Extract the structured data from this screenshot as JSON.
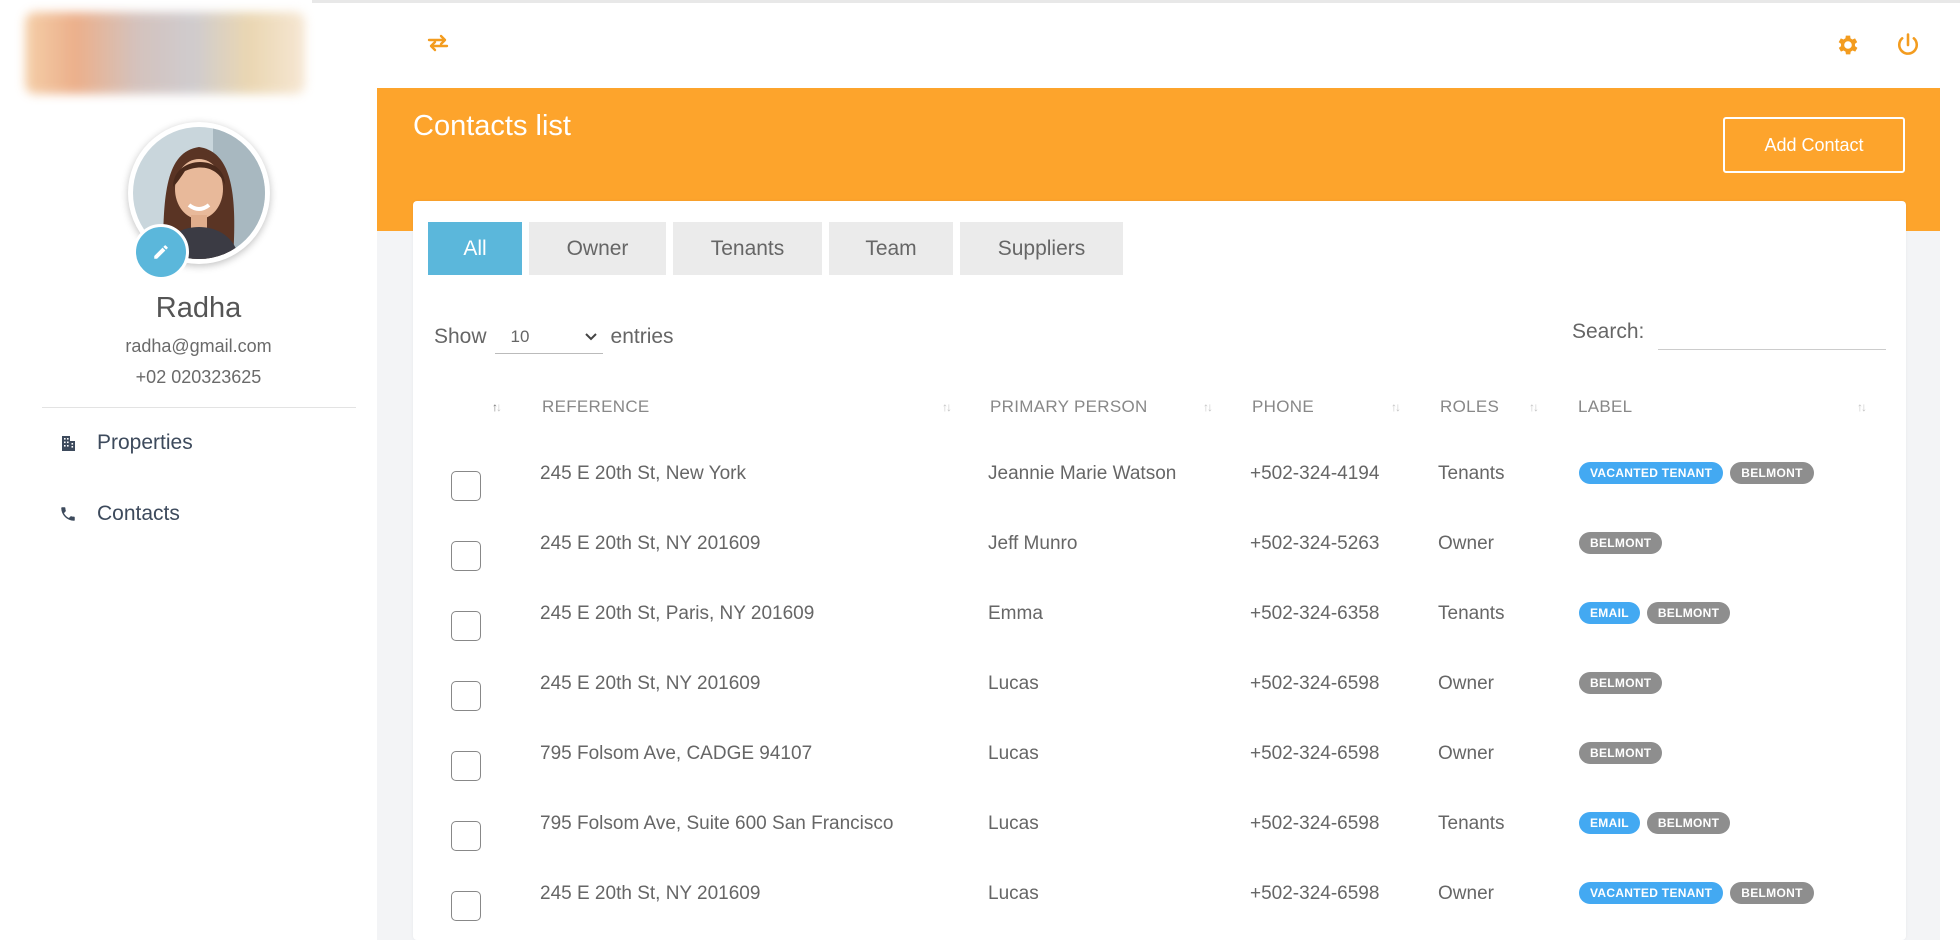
{
  "profile": {
    "name": "Radha",
    "email": "radha@gmail.com",
    "phone": "+02 020323625"
  },
  "nav": {
    "properties_label": "Properties",
    "contacts_label": "Contacts"
  },
  "page": {
    "title": "Contacts list",
    "add_button_label": "Add Contact"
  },
  "tabs": [
    {
      "label": "All",
      "active": true
    },
    {
      "label": "Owner",
      "active": false
    },
    {
      "label": "Tenants",
      "active": false
    },
    {
      "label": "Team",
      "active": false
    },
    {
      "label": "Suppliers",
      "active": false
    }
  ],
  "table_controls": {
    "show_label": "Show",
    "entries_value": "10",
    "entries_label": "entries",
    "search_label": "Search:",
    "search_value": ""
  },
  "columns": {
    "reference": "REFERENCE",
    "primary_person": "PRIMARY PERSON",
    "phone": "PHONE",
    "roles": "ROLES",
    "label": "LABEL"
  },
  "rows": [
    {
      "reference": "245 E 20th St, New York",
      "person": "Jeannie Marie Watson",
      "phone": "+502-324-4194",
      "role": "Tenants",
      "labels": [
        "VACANTED TENANT",
        "BELMONT"
      ]
    },
    {
      "reference": "245 E 20th St, NY 201609",
      "person": "Jeff Munro",
      "phone": "+502-324-5263",
      "role": "Owner",
      "labels": [
        "BELMONT"
      ]
    },
    {
      "reference": "245 E 20th St, Paris, NY 201609",
      "person": "Emma",
      "phone": "+502-324-6358",
      "role": "Tenants",
      "labels": [
        "EMAIL",
        "BELMONT"
      ]
    },
    {
      "reference": "245 E 20th St, NY 201609",
      "person": "Lucas",
      "phone": "+502-324-6598",
      "role": "Owner",
      "labels": [
        "BELMONT"
      ]
    },
    {
      "reference": "795 Folsom Ave, CADGE 94107",
      "person": "Lucas",
      "phone": "+502-324-6598",
      "role": "Owner",
      "labels": [
        "BELMONT"
      ]
    },
    {
      "reference": "795 Folsom Ave, Suite 600 San Francisco",
      "person": "Lucas",
      "phone": "+502-324-6598",
      "role": "Tenants",
      "labels": [
        "EMAIL",
        "BELMONT"
      ]
    },
    {
      "reference": "245 E 20th St, NY 201609",
      "person": "Lucas",
      "phone": "+502-324-6598",
      "role": "Owner",
      "labels": [
        "VACANTED TENANT",
        "BELMONT"
      ]
    }
  ],
  "colors": {
    "accent_orange": "#fda42c",
    "tab_active_blue": "#5bb7db",
    "badge_blue": "#43a9f2",
    "badge_gray": "#8e8e8e"
  },
  "icons": {
    "top_left": "swap-arrows-icon",
    "top_right": [
      "gear-icon",
      "power-icon"
    ],
    "edit": "pencil-icon",
    "properties": "building-icon",
    "contacts": "phone-icon"
  }
}
